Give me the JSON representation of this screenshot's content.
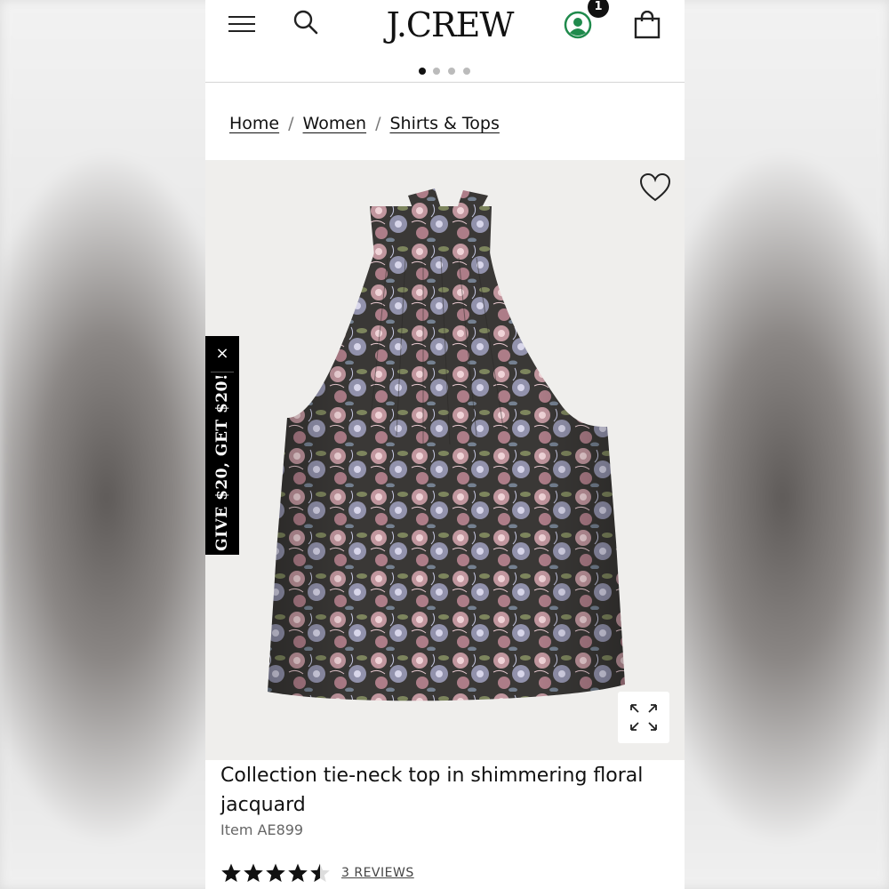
{
  "header": {
    "logo_text": "J.CREW",
    "account_badge_count": "1",
    "icons": {
      "menu": "hamburger-menu-icon",
      "search": "search-icon",
      "account": "account-icon",
      "bag": "shopping-bag-icon"
    },
    "account_color": "#1f8a4c"
  },
  "carousel": {
    "dot_count": 4,
    "active_index": 0
  },
  "breadcrumb": {
    "items": [
      "Home",
      "Women",
      "Shirts & Tops"
    ],
    "separator": "/"
  },
  "product_image": {
    "wishlist_icon": "heart-outline-icon",
    "expand_icon": "expand-arrows-icon",
    "background": "#efeeec"
  },
  "referral_tab": {
    "text": "GIVE $20, GET $20!",
    "close_label": "×"
  },
  "product": {
    "title": "Collection tie-neck top in shimmering floral jacquard",
    "item_number": "Item AE899",
    "rating": 4.5,
    "rating_max": 5,
    "reviews_label": "3 REVIEWS"
  }
}
